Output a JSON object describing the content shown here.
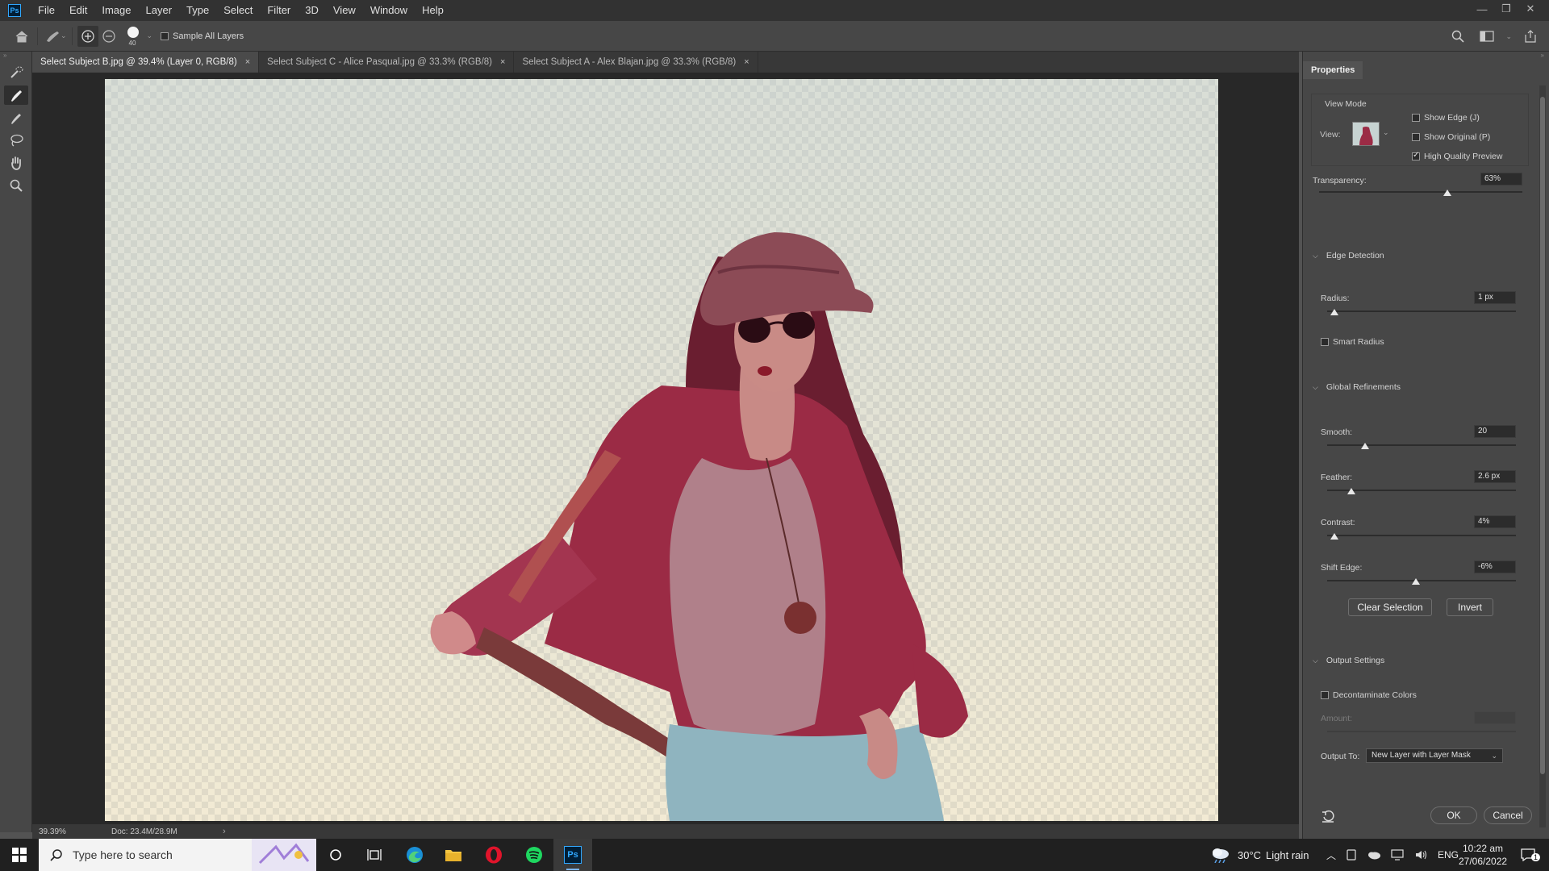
{
  "app": {
    "logo_text": "Ps"
  },
  "menu": [
    "File",
    "Edit",
    "Image",
    "Layer",
    "Type",
    "Select",
    "Filter",
    "3D",
    "View",
    "Window",
    "Help"
  ],
  "options_bar": {
    "brush_size": "40",
    "sample_all_layers_label": "Sample All Layers",
    "sample_all_layers_checked": false
  },
  "tabs": [
    {
      "label": "Select Subject B.jpg @ 39.4% (Layer 0, RGB/8)",
      "active": true
    },
    {
      "label": "Select Subject C - Alice Pasqual.jpg @ 33.3% (RGB/8)",
      "active": false
    },
    {
      "label": "Select Subject A - Alex Blajan.jpg @ 33.3% (RGB/8)",
      "active": false
    }
  ],
  "status": {
    "zoom": "39.39%",
    "doc": "Doc: 23.4M/28.9M"
  },
  "properties": {
    "panel_title": "Properties",
    "view_mode": {
      "heading": "View Mode",
      "view_label": "View:",
      "show_edge": {
        "label": "Show Edge (J)",
        "checked": false
      },
      "show_original": {
        "label": "Show Original (P)",
        "checked": false
      },
      "high_quality": {
        "label": "High Quality Preview",
        "checked": true
      }
    },
    "transparency": {
      "label": "Transparency:",
      "value": "63%",
      "fraction": 0.63
    },
    "edge_detection": {
      "heading": "Edge Detection",
      "radius": {
        "label": "Radius:",
        "value": "1 px",
        "fraction": 0.04
      },
      "smart_radius": {
        "label": "Smart Radius",
        "checked": false
      }
    },
    "global_refinements": {
      "heading": "Global Refinements",
      "smooth": {
        "label": "Smooth:",
        "value": "20",
        "fraction": 0.2
      },
      "feather": {
        "label": "Feather:",
        "value": "2.6 px",
        "fraction": 0.13
      },
      "contrast": {
        "label": "Contrast:",
        "value": "4%",
        "fraction": 0.04
      },
      "shift_edge": {
        "label": "Shift Edge:",
        "value": "-6%",
        "fraction": 0.47
      }
    },
    "clear_selection_label": "Clear Selection",
    "invert_label": "Invert",
    "output_settings": {
      "heading": "Output Settings",
      "decontaminate": {
        "label": "Decontaminate Colors",
        "checked": false
      },
      "amount_label": "Amount:",
      "output_to_label": "Output To:",
      "output_to_value": "New Layer with Layer Mask"
    },
    "ok_label": "OK",
    "cancel_label": "Cancel"
  },
  "taskbar": {
    "search_placeholder": "Type here to search",
    "weather_temp": "30°C",
    "weather_text": "Light rain",
    "language": "ENG",
    "time": "10:22 am",
    "date": "27/06/2022",
    "notification_count": "1"
  },
  "colors": {
    "accent": "#31a8ff",
    "panel_bg": "#474747",
    "canvas_bg": "#282828",
    "overlay": "#9c1c3c"
  }
}
